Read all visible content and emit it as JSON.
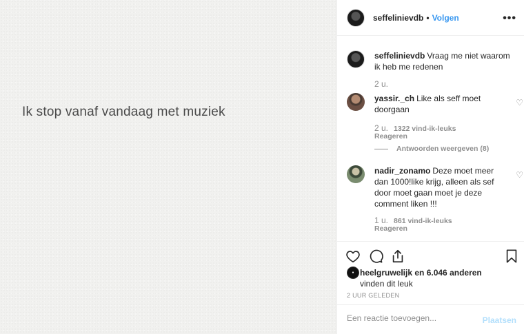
{
  "post": {
    "image_text": "Ik stop vanaf vandaag met muziek"
  },
  "header": {
    "username": "seffelinievdb",
    "separator": "•",
    "follow_label": "Volgen",
    "more_label": "•••"
  },
  "comments": [
    {
      "username": "seffelinievdb",
      "text": "Vraag me niet waarom ik heb me redenen",
      "time": "2 u."
    },
    {
      "username": "yassir._ch",
      "text": "Like als seff moet doorgaan",
      "time": "2 u.",
      "likes": "1322 vind-ik-leuks",
      "reply_label": "Reageren",
      "view_replies": "Antwoorden weergeven (8)"
    },
    {
      "username": "nadir_zonamo",
      "text": "Deze moet meer dan 1000!like krijg, alleen als sef door moet gaan moet je deze comment liken !!!",
      "time": "1 u.",
      "likes": "861 vind-ik-leuks",
      "reply_label": "Reageren"
    }
  ],
  "likes_summary": {
    "user": "heelgruwelijk",
    "rest": " en 6.046 anderen",
    "suffix": "vinden dit leuk"
  },
  "time_ago": "2 UUR GELEDEN",
  "add_comment": {
    "placeholder": "Een reactie toevoegen...",
    "post_label": "Plaatsen"
  },
  "colors": {
    "accent": "#3897f0",
    "post_disabled": "#b2dffc",
    "muted": "#8e8e8e",
    "text": "#262626"
  }
}
